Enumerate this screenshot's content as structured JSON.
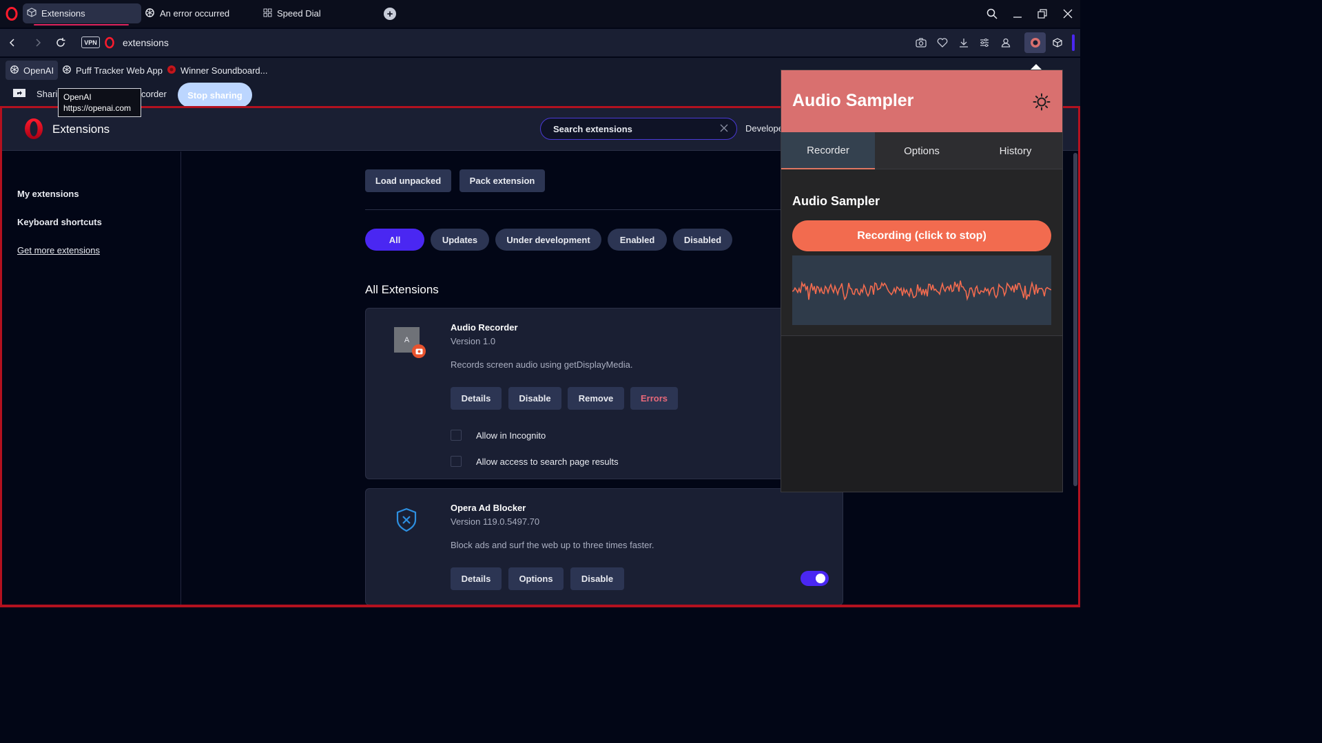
{
  "tabs": [
    {
      "label": "Extensions",
      "icon": "cube-icon",
      "active": true
    },
    {
      "label": "An error occurred",
      "icon": "openai-icon",
      "active": false
    },
    {
      "label": "Speed Dial",
      "icon": "grid-icon",
      "active": false
    }
  ],
  "address": {
    "vpn_label": "VPN",
    "url": "extensions"
  },
  "bookmarks": [
    {
      "label": "OpenAI",
      "icon": "openai-icon"
    },
    {
      "label": "Puff Tracker Web App",
      "icon": "openai-icon"
    },
    {
      "label": "Winner Soundboard...",
      "icon": "red-circle-icon"
    }
  ],
  "sharebar": {
    "text_left": "Sharir",
    "text_right": "corder",
    "stop_label": "Stop sharing"
  },
  "tooltip": {
    "title": "OpenAI",
    "url": "https://openai.com"
  },
  "extensions_page": {
    "title": "Extensions",
    "search_placeholder": "Search extensions",
    "developer_label": "Develope",
    "sidebar": {
      "my_extensions": "My extensions",
      "keyboard_shortcuts": "Keyboard shortcuts",
      "get_more": "Get more extensions"
    },
    "load_unpacked": "Load unpacked",
    "pack_extension": "Pack extension",
    "filters": [
      "All",
      "Updates",
      "Under development",
      "Enabled",
      "Disabled"
    ],
    "section_title": "All Extensions",
    "cards": [
      {
        "name": "Audio Recorder",
        "version": "Version 1.0",
        "description": "Records screen audio using getDisplayMedia.",
        "icon_letter": "A",
        "buttons": [
          "Details",
          "Disable",
          "Remove",
          "Errors"
        ],
        "checkboxes": [
          "Allow in Incognito",
          "Allow access to search page results"
        ]
      },
      {
        "name": "Opera Ad Blocker",
        "version": "Version 119.0.5497.70",
        "description": "Block ads and surf the web up to three times faster.",
        "buttons": [
          "Details",
          "Options",
          "Disable"
        ],
        "toggle_enabled": true
      }
    ]
  },
  "popup": {
    "title": "Audio Sampler",
    "tabs": [
      "Recorder",
      "Options",
      "History"
    ],
    "active_tab": "Recorder",
    "section_heading": "Audio Sampler",
    "record_button": "Recording (click to stop)",
    "colors": {
      "header": "#d9706f",
      "button": "#f26b4f",
      "wave": "#f26b4f"
    }
  },
  "colors": {
    "accent": "#4a27f2",
    "opera_red": "#e0245e",
    "frame_red": "#b3111f"
  }
}
